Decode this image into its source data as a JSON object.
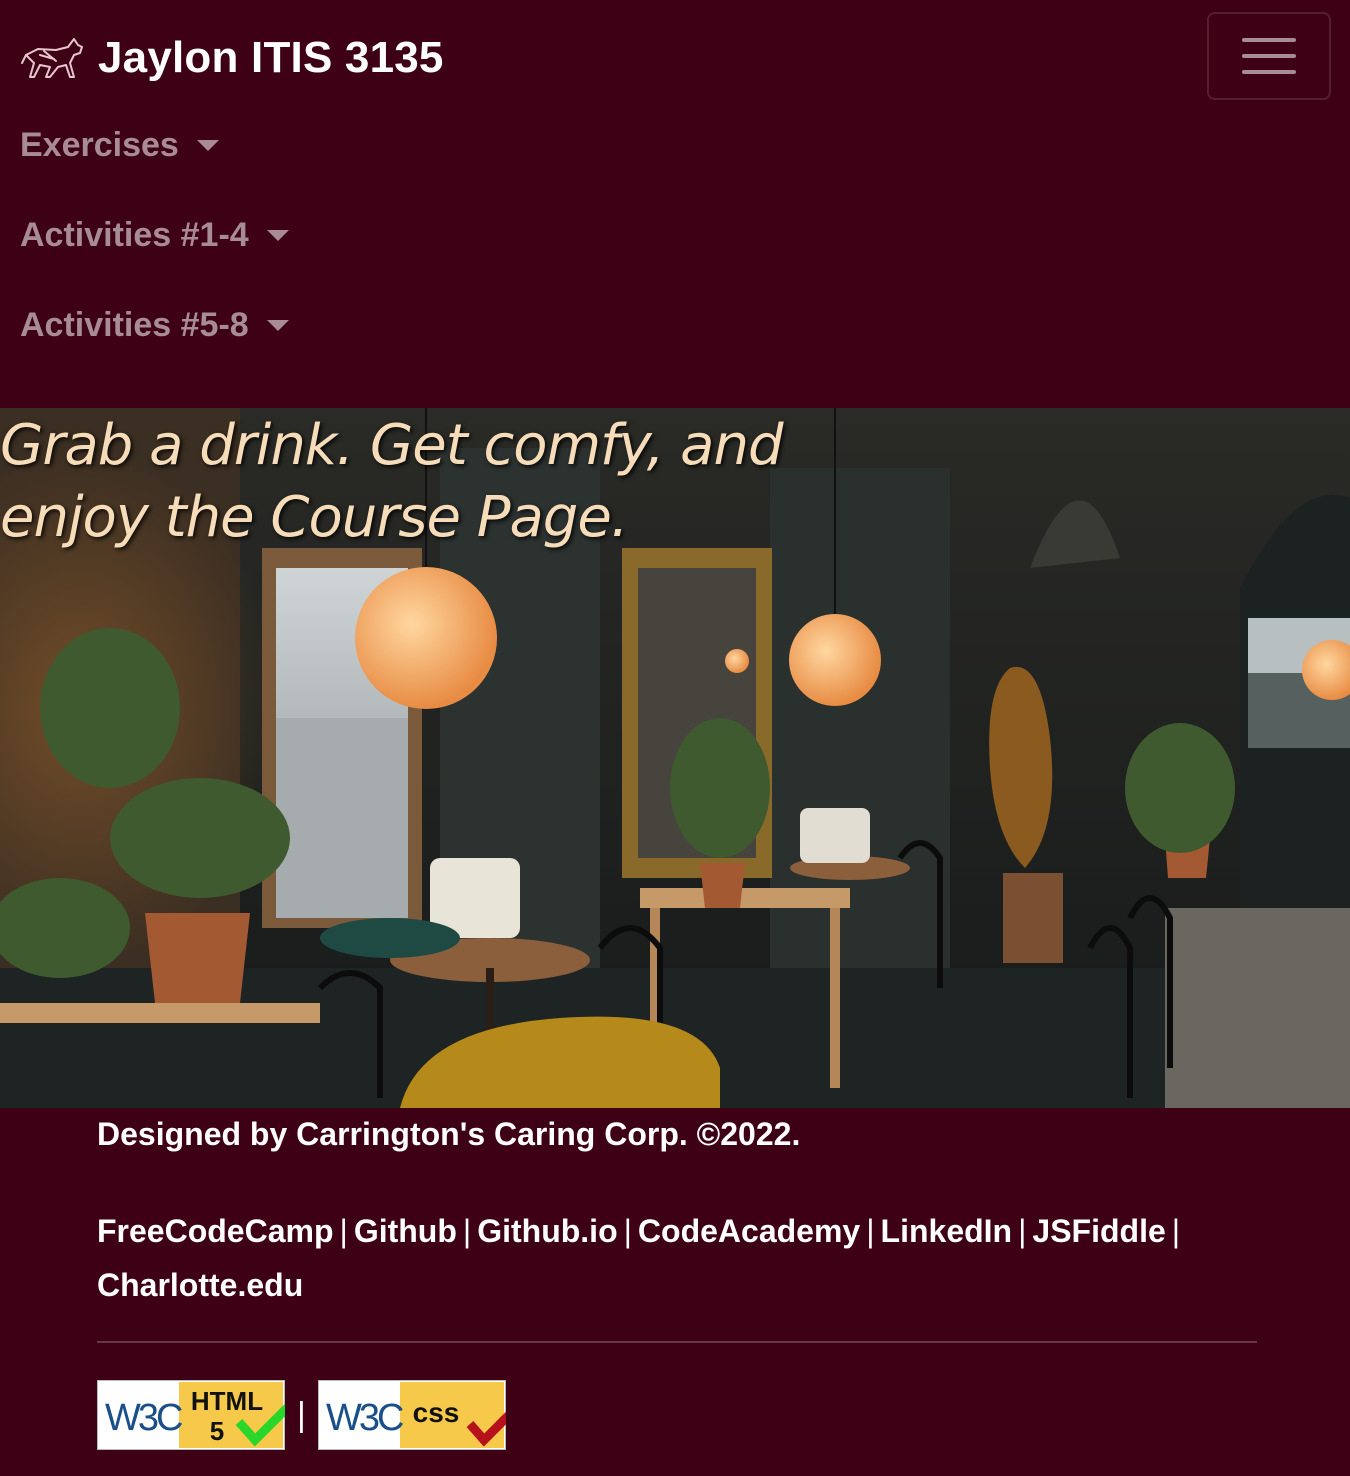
{
  "navbar": {
    "brand_text": "Jaylon ITIS 3135",
    "brand_logo_icon": "panther-icon",
    "toggler_icon": "hamburger-menu-icon",
    "menu": [
      {
        "label": "Exercises"
      },
      {
        "label": "Activities #1-4"
      },
      {
        "label": "Activities #5-8"
      }
    ]
  },
  "hero": {
    "heading": "Grab a drink. Get comfy, and enjoy the Course Page.",
    "image_subject": "cafe interior photo"
  },
  "footer": {
    "credit": "Designed by Carrington's Caring Corp. ©2022.",
    "links": [
      {
        "label": "FreeCodeCamp"
      },
      {
        "label": "Github"
      },
      {
        "label": "Github.io"
      },
      {
        "label": "CodeAcademy"
      },
      {
        "label": "LinkedIn"
      },
      {
        "label": "JSFiddle"
      },
      {
        "label": "Charlotte.edu"
      }
    ],
    "separator": "|",
    "badges": [
      {
        "w3c": "W3C",
        "label_line1": "HTML",
        "label_line2": "5",
        "check_color": "#2bd62b"
      },
      {
        "w3c": "W3C",
        "label_line1": "css",
        "label_line2": "",
        "check_color": "#b5121b"
      }
    ]
  },
  "colors": {
    "background": "#3e0014",
    "nav_muted": "rgba(255,255,255,0.55)",
    "hero_text": "#f6dcb9",
    "badge_yellow": "#f6c94a"
  }
}
